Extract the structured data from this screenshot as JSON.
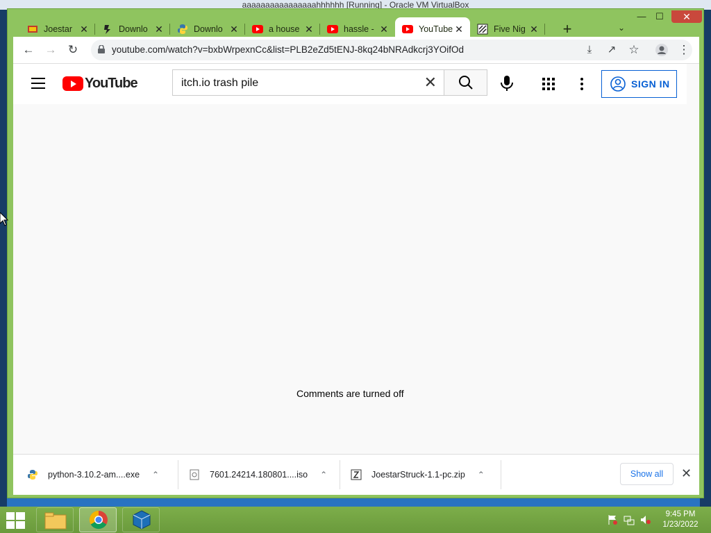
{
  "vbox_title": "aaaaaaaaaaaaaaaahhhhhh [Running] - Oracle VM VirtualBox",
  "tabs": [
    {
      "title": "Joestar",
      "icon": "joestar-favicon"
    },
    {
      "title": "Downlo",
      "icon": "download-favicon"
    },
    {
      "title": "Downlo",
      "icon": "python-favicon"
    },
    {
      "title": "a house",
      "icon": "youtube-favicon"
    },
    {
      "title": "hassle -",
      "icon": "youtube-favicon"
    },
    {
      "title": "YouTube",
      "icon": "youtube-favicon",
      "active": true
    },
    {
      "title": "Five Nig",
      "icon": "fnaf-favicon"
    }
  ],
  "toolbar": {
    "url": "youtube.com/watch?v=bxbWrpexnCc&list=PLB2eZd5tENJ-8kq24bNRAdkcrj3YOifOd"
  },
  "youtube": {
    "logo_text": "YouTube",
    "search_value": "itch.io trash pile",
    "sign_in_label": "SIGN IN",
    "comments_message": "Comments are turned off"
  },
  "downloads": {
    "items": [
      {
        "name": "python-3.10.2-am....exe",
        "icon": "python-file-icon"
      },
      {
        "name": "7601.24214.180801....iso",
        "icon": "disc-file-icon"
      },
      {
        "name": "JoestarStruck-1.1-pc.zip",
        "icon": "zip-file-icon"
      }
    ],
    "show_all_label": "Show all"
  },
  "taskbar": {
    "time": "9:45 PM",
    "date": "1/23/2022"
  },
  "colors": {
    "chrome_frame": "#8fc45f",
    "youtube_red": "#ff0000",
    "link_blue": "#065fd4",
    "taskbar_green": "#7dae4a"
  }
}
